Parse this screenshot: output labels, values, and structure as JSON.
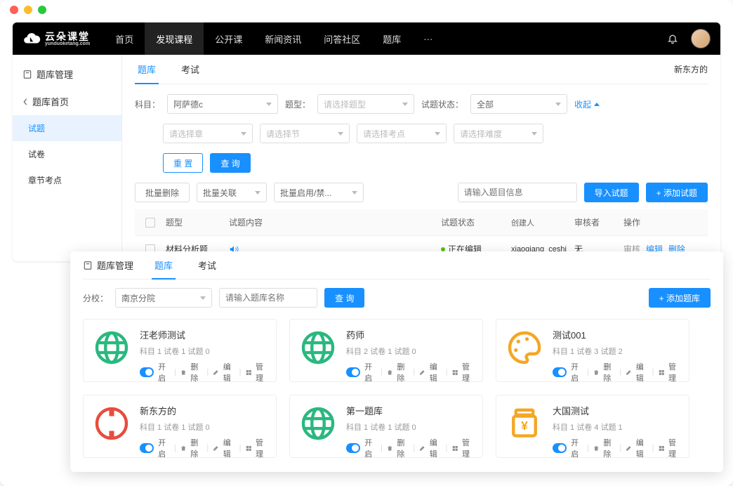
{
  "logo": {
    "main": "云朵课堂",
    "sub": "yunduoketang.com"
  },
  "nav": [
    "首页",
    "发现课程",
    "公开课",
    "新闻资讯",
    "问答社区",
    "题库",
    "···"
  ],
  "nav_active": 1,
  "sidebar": {
    "title": "题库管理",
    "back": "题库首页",
    "items": [
      "试题",
      "试卷",
      "章节考点"
    ],
    "active": 0
  },
  "tabs1": {
    "items": [
      "题库",
      "考试"
    ],
    "active": 0,
    "right": "新东方的"
  },
  "filters": {
    "subject_label": "科目：",
    "subject_value": "阿萨德c",
    "type_label": "题型：",
    "type_ph": "请选择题型",
    "status_label": "试题状态：",
    "status_value": "全部",
    "collapse": "收起",
    "chapter_ph": "请选择章",
    "section_ph": "请选择节",
    "point_ph": "请选择考点",
    "difficulty_ph": "请选择难度",
    "reset": "重 置",
    "query": "查 询"
  },
  "bulk": {
    "delete": "批量删除",
    "relate": "批量关联",
    "toggle": "批量启用/禁..."
  },
  "search_ph": "请输入题目信息",
  "import_btn": "导入试题",
  "add_btn": "+ 添加试题",
  "table": {
    "head": [
      "题型",
      "试题内容",
      "试题状态",
      "创建人",
      "审核者",
      "操作"
    ],
    "row": {
      "type": "材料分析题",
      "content": "",
      "status": "正在编辑",
      "creator": "xiaoqiang_ceshi",
      "reviewer": "无",
      "ops": [
        "审核",
        "编辑",
        "删除"
      ]
    }
  },
  "win2": {
    "head_title": "题库管理",
    "tabs": [
      "题库",
      "考试"
    ],
    "active": 0,
    "branch_label": "分校：",
    "branch_value": "南京分院",
    "search_ph": "请输入题库名称",
    "query": "查 询",
    "add": "+ 添加题库",
    "cards": [
      {
        "title": "汪老师测试",
        "meta": "科目 1  试卷 1  试题 0",
        "icon": "globe-green"
      },
      {
        "title": "药师",
        "meta": "科目 2  试卷 1  试题 0",
        "icon": "globe-green"
      },
      {
        "title": "测试001",
        "meta": "科目 1  试卷 3  试题 2",
        "icon": "palette-orange"
      },
      {
        "title": "新东方的",
        "meta": "科目 1  试卷 1  试题 0",
        "icon": "circle-red"
      },
      {
        "title": "第一题库",
        "meta": "科目 1  试卷 1  试题 0",
        "icon": "globe-green"
      },
      {
        "title": "大国测试",
        "meta": "科目 1  试卷 4  试题 1",
        "icon": "jar-orange"
      }
    ],
    "card_labels": {
      "on": "开启",
      "delete": "删除",
      "edit": "编辑",
      "manage": "管理"
    }
  }
}
